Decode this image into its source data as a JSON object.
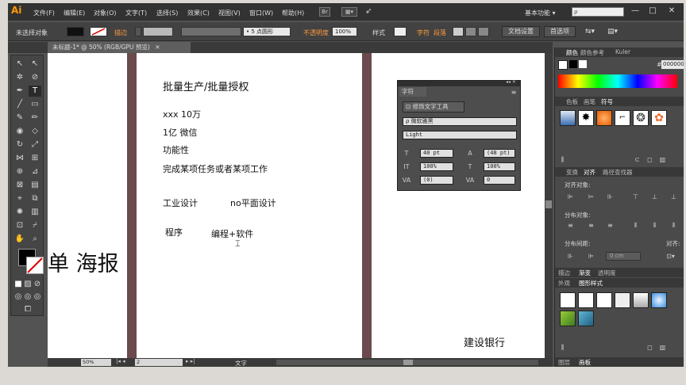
{
  "menubar": {
    "logo": "Ai",
    "items": [
      "文件(F)",
      "编辑(E)",
      "对象(O)",
      "文字(T)",
      "选择(S)",
      "效果(C)",
      "视图(V)",
      "窗口(W)",
      "帮助(H)"
    ],
    "bridge_label": "Br",
    "workspace": "基本功能",
    "search_placeholder": "ρ"
  },
  "controlbar": {
    "selection_status": "未选择对象",
    "stroke_label": "描边",
    "brush_value": "5 点圆形",
    "opacity_label": "不透明度",
    "opacity_value": "100%",
    "style_label": "样式",
    "char_label": "字符",
    "para_label": "段落",
    "doc_setup": "文档设置",
    "preferences": "首选项"
  },
  "document": {
    "tab_title": "未标题-1* @ 50% (RGB/GPU 预览)"
  },
  "canvas": {
    "left_text": "单 海报",
    "lines": [
      "批量生产/批量授权",
      "xxx  10万",
      "1亿  微信",
      "功能性",
      "完成某项任务或者某项工作",
      "工业设计",
      "no平面设计",
      "程序",
      "编程+软件"
    ],
    "right_text": "建设银行"
  },
  "char_panel": {
    "title": "字符",
    "touch_tool": "修饰文字工具",
    "font_family": "微软雅黑",
    "font_style": "Light",
    "font_size": "40 pt",
    "leading": "(48 pt)",
    "vscale": "100%",
    "hscale": "100%",
    "kerning": "(0)",
    "tracking": "0"
  },
  "statusbar": {
    "zoom": "50%",
    "artboard": "2",
    "tool": "文字"
  },
  "right_panels": {
    "color_tabs": [
      "颜色",
      "颜色参考",
      "Kuler"
    ],
    "hex_value": "000000",
    "swatch_tabs": [
      "色板",
      "画笔",
      "符号"
    ],
    "align_tabs": [
      "变换",
      "对齐",
      "路径查找器"
    ],
    "align_objects": "对齐对象:",
    "distribute_objects": "分布对象:",
    "distribute_spacing": "分布间距:",
    "align_to": "对齐:",
    "spacing_value": "0 cm",
    "stroke_tabs": [
      "描边",
      "渐变",
      "透明度"
    ],
    "appearance_tabs": [
      "外观",
      "图形样式"
    ],
    "bottom_tabs": [
      "图层",
      "画板"
    ]
  },
  "colors": {
    "artboard_edge": "#6b4a4e",
    "accent_orange": "#ff9a3c"
  }
}
